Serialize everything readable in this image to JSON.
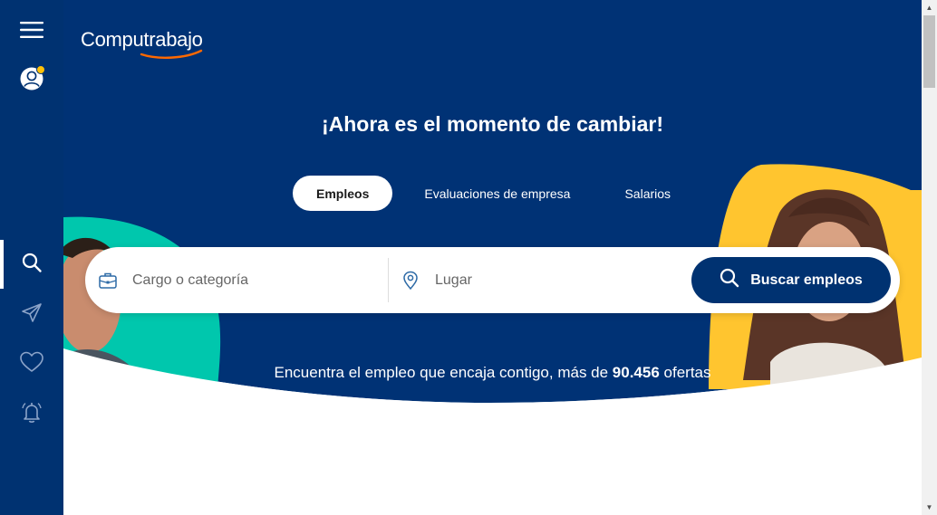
{
  "brand": {
    "name": "Computrabajo"
  },
  "hero": {
    "headline": "¡Ahora es el momento de cambiar!",
    "tabs": [
      {
        "label": "Empleos",
        "active": true
      },
      {
        "label": "Evaluaciones de empresa",
        "active": false
      },
      {
        "label": "Salarios",
        "active": false
      }
    ]
  },
  "search": {
    "job_placeholder": "Cargo o categoría",
    "location_placeholder": "Lugar",
    "button_label": "Buscar empleos"
  },
  "tagline": {
    "prefix": "Encuentra el empleo que encaja contigo, más de ",
    "count": "90.456",
    "suffix": " ofertas"
  },
  "sidebar": {
    "items": [
      "menu-icon",
      "user-icon",
      "search-icon",
      "send-icon",
      "heart-icon",
      "bell-icon"
    ],
    "notification_dot": true
  },
  "colors": {
    "navy": "#003271",
    "hero_blue": "#003275",
    "teal": "#00c7ad",
    "yellow": "#ffc52f",
    "accent_orange": "#ff6900",
    "white": "#ffffff"
  }
}
